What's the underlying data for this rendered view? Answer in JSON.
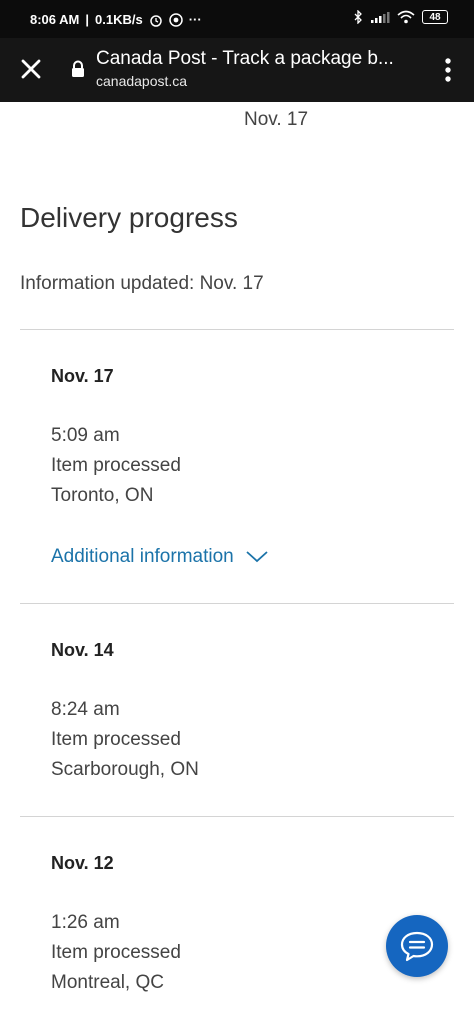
{
  "status_bar": {
    "time": "8:06 AM",
    "speed": "0.1KB/s",
    "battery": "48"
  },
  "browser": {
    "title": "Canada Post - Track a package b...",
    "url": "canadapost.ca"
  },
  "page": {
    "top_date": "Nov. 17",
    "heading": "Delivery progress",
    "updated": "Information updated: Nov. 17",
    "additional_info": "Additional information",
    "events": [
      {
        "date": "Nov. 17",
        "time": "5:09 am",
        "status": "Item processed",
        "location": "Toronto, ON"
      },
      {
        "date": "Nov. 14",
        "time": "8:24 am",
        "status": "Item processed",
        "location": "Scarborough, ON"
      },
      {
        "date": "Nov. 12",
        "time": "1:26 am",
        "status": "Item processed",
        "location": "Montreal, QC"
      }
    ]
  },
  "icons": {
    "close": "close-icon",
    "lock": "lock-icon",
    "menu": "more-vert-icon",
    "chevron": "chevron-down-icon",
    "chat": "chat-icon"
  },
  "colors": {
    "status_bar_bg": "#0c0c0c",
    "toolbar_bg": "#161616",
    "link": "#1b73a9",
    "chat_button": "#1566c0"
  }
}
